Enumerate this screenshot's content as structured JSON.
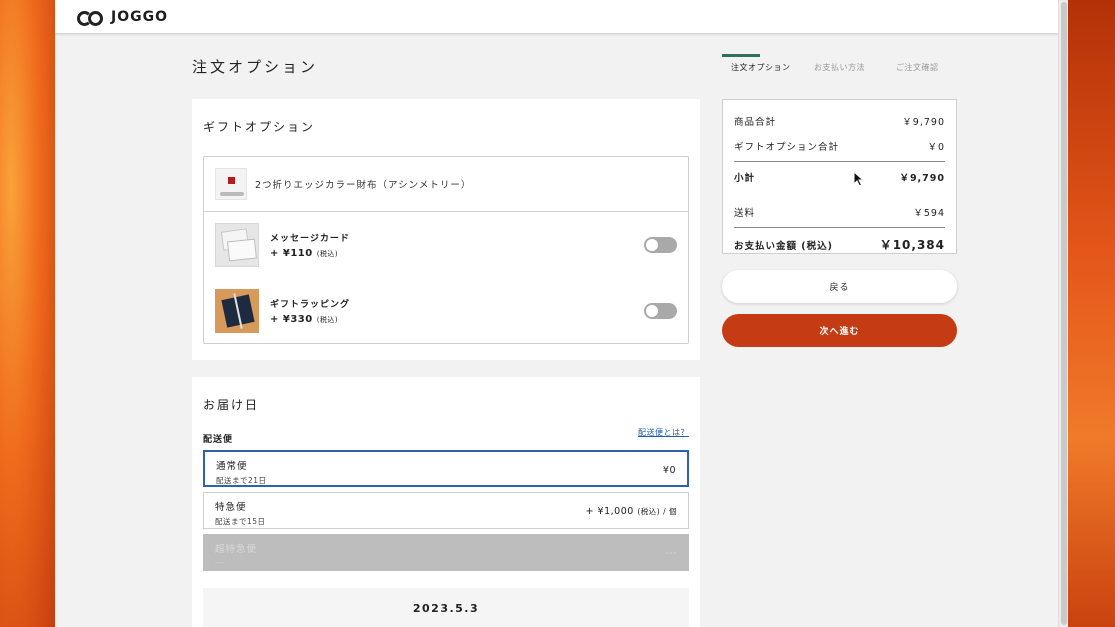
{
  "brand": {
    "name": "JOGGO"
  },
  "page": {
    "title": "注文オプション"
  },
  "steps": [
    {
      "label": "注文オプション",
      "active": true
    },
    {
      "label": "お支払い方法",
      "active": false
    },
    {
      "label": "ご注文確認",
      "active": false
    }
  ],
  "gift": {
    "title": "ギフトオプション",
    "product_name": "2つ折りエッジカラー財布（アシンメトリー）",
    "options": [
      {
        "name": "メッセージカード",
        "price": "+ ¥110",
        "tax": "(税込)",
        "enabled": false
      },
      {
        "name": "ギフトラッピング",
        "price": "+ ¥330",
        "tax": "(税込)",
        "enabled": false
      }
    ]
  },
  "delivery": {
    "title": "お届け日",
    "method_label": "配送便",
    "help_link": "配送便とは？",
    "options": [
      {
        "name": "通常便",
        "sub": "配送まで21日",
        "price": "¥0",
        "price_suffix": "",
        "selected": true,
        "disabled": false
      },
      {
        "name": "特急便",
        "sub": "配送まで15日",
        "price": "+ ¥1,000",
        "price_suffix": "(税込) / 個",
        "selected": false,
        "disabled": false
      },
      {
        "name": "超特急便",
        "sub": "---",
        "price": "---",
        "price_suffix": "",
        "selected": false,
        "disabled": true
      }
    ],
    "date": "2023.5.3"
  },
  "summary": {
    "items_label": "商品合計",
    "items_value": "￥9,790",
    "gift_label": "ギフトオプション合計",
    "gift_value": "￥0",
    "subtotal_label": "小計",
    "subtotal_value": "￥9,790",
    "shipping_label": "送料",
    "shipping_value": "￥594",
    "total_label": "お支払い金額 (税込)",
    "total_value": "￥10,384"
  },
  "buttons": {
    "back": "戻る",
    "next": "次へ進む"
  },
  "colors": {
    "accent": "#c53c14",
    "step_active": "#2f6f5e",
    "selected_border": "#2f63a7",
    "link": "#1f5fa8"
  }
}
